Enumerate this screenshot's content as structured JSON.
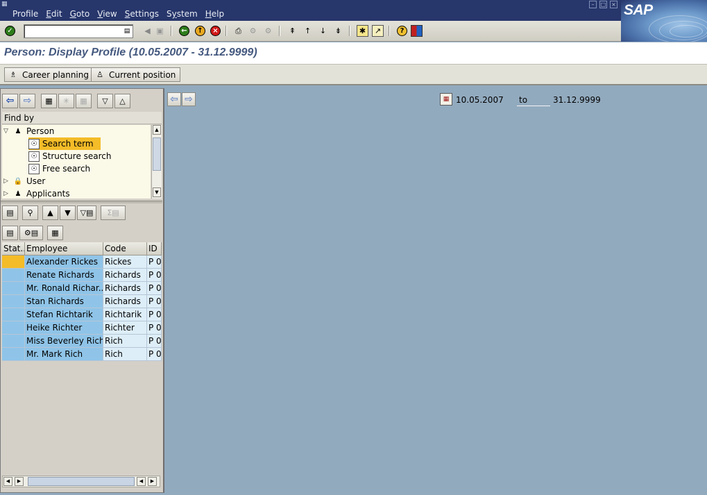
{
  "menu": {
    "items": [
      {
        "label": "Profile",
        "underline": ""
      },
      {
        "label": "Edit",
        "underline": "E"
      },
      {
        "label": "Goto",
        "underline": "G"
      },
      {
        "label": "View",
        "underline": "V"
      },
      {
        "label": "Settings",
        "underline": "S"
      },
      {
        "label": "System",
        "underline": "y"
      },
      {
        "label": "Help",
        "underline": "H"
      }
    ],
    "logo": "SAP"
  },
  "toolbar": {
    "command_value": "",
    "icons": [
      "enter-icon",
      "save-icon",
      "back-icon",
      "exit-icon",
      "cancel-icon",
      "print-icon",
      "find-icon",
      "find-next-icon",
      "first-page-icon",
      "previous-page-icon",
      "next-page-icon",
      "last-page-icon",
      "create-session-icon",
      "shortcut-icon",
      "help-icon",
      "layout-icon"
    ]
  },
  "title": "Person: Display Profile (10.05.2007 - 31.12.9999)",
  "app_toolbar": {
    "career_planning": "Career planning",
    "current_position": "Current position"
  },
  "left": {
    "find_by": "Find by",
    "tree": [
      {
        "label": "Person",
        "level": 0,
        "expanded": true
      },
      {
        "label": "Search term",
        "level": 1,
        "selected": true
      },
      {
        "label": "Structure search",
        "level": 1
      },
      {
        "label": "Free search",
        "level": 1
      },
      {
        "label": "User",
        "level": 0,
        "expanded": false
      },
      {
        "label": "Applicants",
        "level": 0,
        "expanded": false
      }
    ],
    "grid": {
      "headers": [
        "Stat...",
        "Employee",
        "Code",
        "ID"
      ],
      "rows": [
        {
          "stat": "",
          "employee": "Alexander Rickes",
          "code": "Rickes",
          "id": "P  0"
        },
        {
          "stat": "",
          "employee": "Renate Richards",
          "code": "Richards",
          "id": "P  0"
        },
        {
          "stat": "",
          "employee": "Mr. Ronald Richar...",
          "code": "Richards",
          "id": "P  0"
        },
        {
          "stat": "",
          "employee": "Stan Richards",
          "code": "Richards",
          "id": "P  0"
        },
        {
          "stat": "",
          "employee": "Stefan Richtarik",
          "code": "Richtarik",
          "id": "P  0"
        },
        {
          "stat": "",
          "employee": "Heike Richter",
          "code": "Richter",
          "id": "P  0"
        },
        {
          "stat": "",
          "employee": "Miss Beverley Rich",
          "code": "Rich",
          "id": "P  0"
        },
        {
          "stat": "",
          "employee": "Mr. Mark Rich",
          "code": "Rich",
          "id": "P  0"
        }
      ]
    }
  },
  "right": {
    "date_from": "10.05.2007",
    "to_label": "to",
    "date_to": "31.12.9999"
  },
  "colors": {
    "menubar": "#27366b",
    "workarea": "#92aabe",
    "selection": "#f4bc28",
    "grid_key": "#8fc4e8"
  }
}
